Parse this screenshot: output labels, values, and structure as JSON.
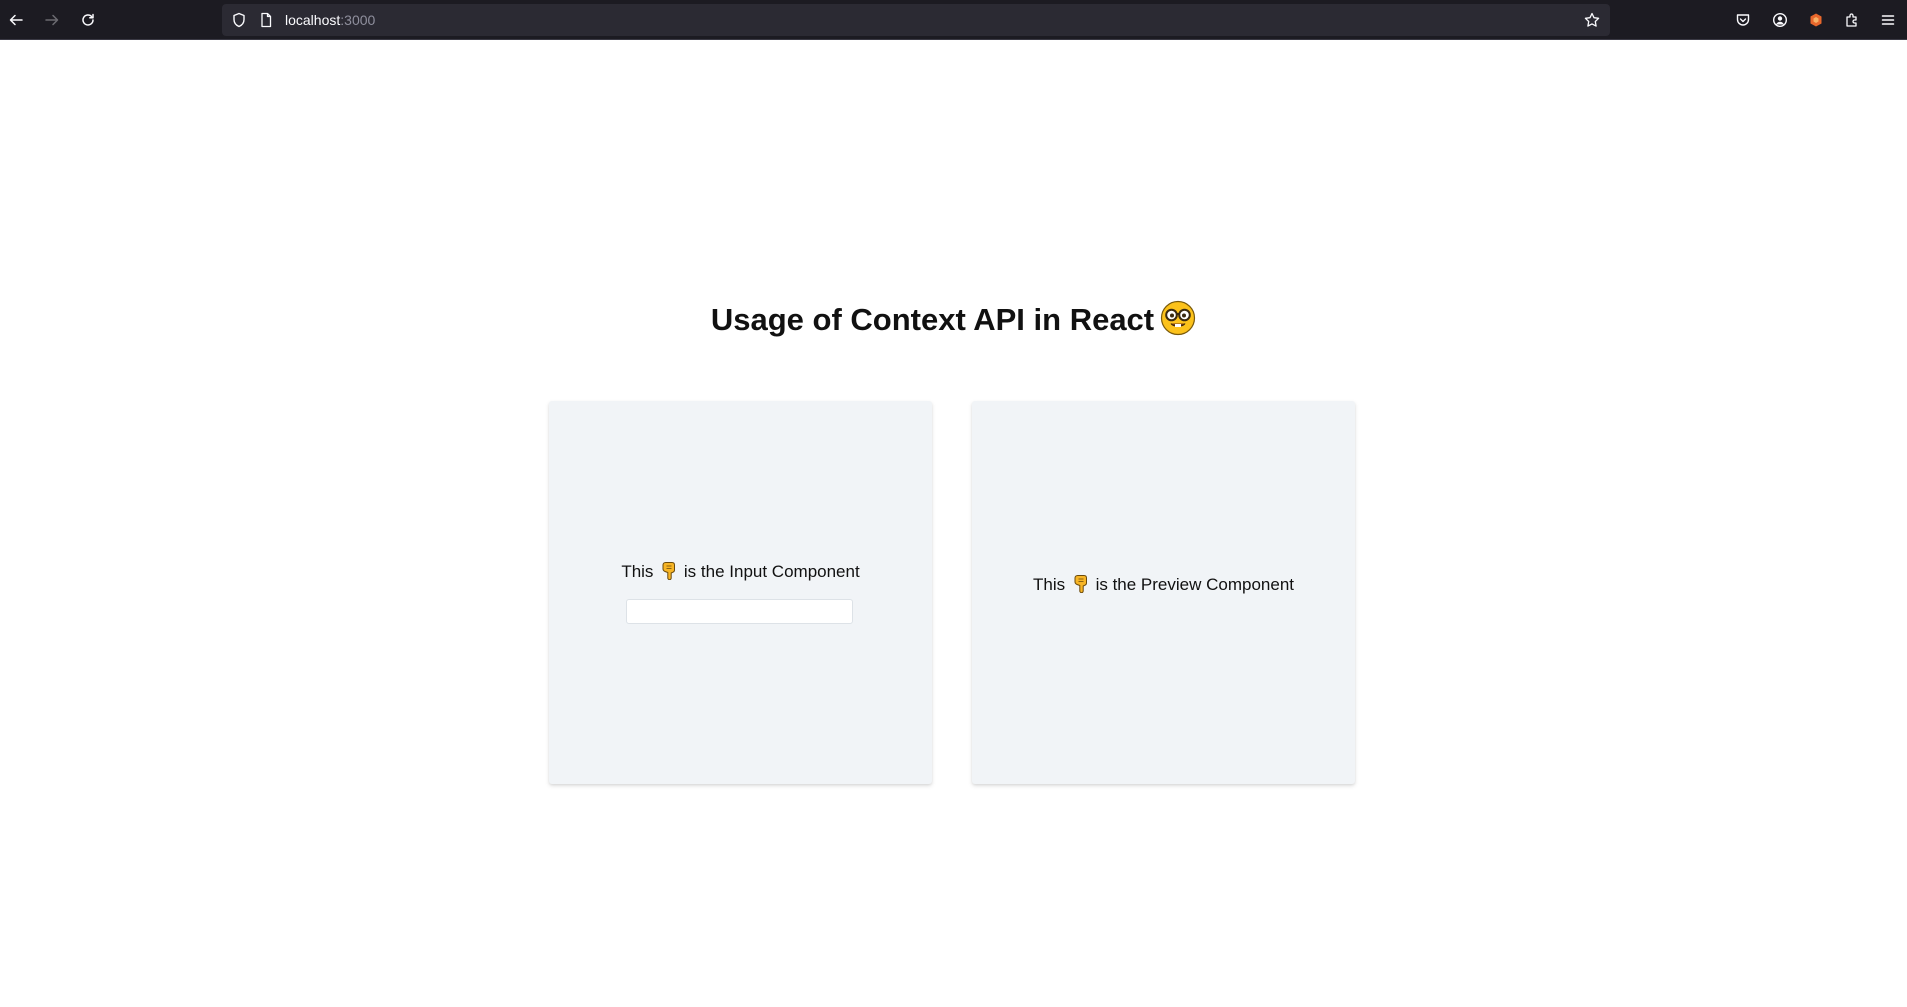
{
  "browser": {
    "url_host": "localhost",
    "url_port": ":3000",
    "icons": {
      "back": "arrow-left-icon",
      "forward": "arrow-right-icon",
      "reload": "reload-icon",
      "tracking": "shield-icon",
      "page": "page-icon",
      "bookmark": "star-icon",
      "pocket": "pocket-icon",
      "account": "account-icon",
      "extension": "extension-badge-icon",
      "extensions": "puzzle-icon",
      "menu": "hamburger-menu-icon"
    }
  },
  "page": {
    "title": "Usage of Context API in React",
    "title_emoji": "nerd-face-icon",
    "input_card": {
      "label_before": "This",
      "label_after": "is the Input Component",
      "input_value": "",
      "input_placeholder": ""
    },
    "preview_card": {
      "label_before": "This",
      "label_after": "is the Preview Component"
    }
  },
  "colors": {
    "toolbar_bg": "#1c1b22",
    "urlbar_bg": "#2b2a33",
    "card_bg": "#f1f4f7",
    "text": "#111111"
  }
}
